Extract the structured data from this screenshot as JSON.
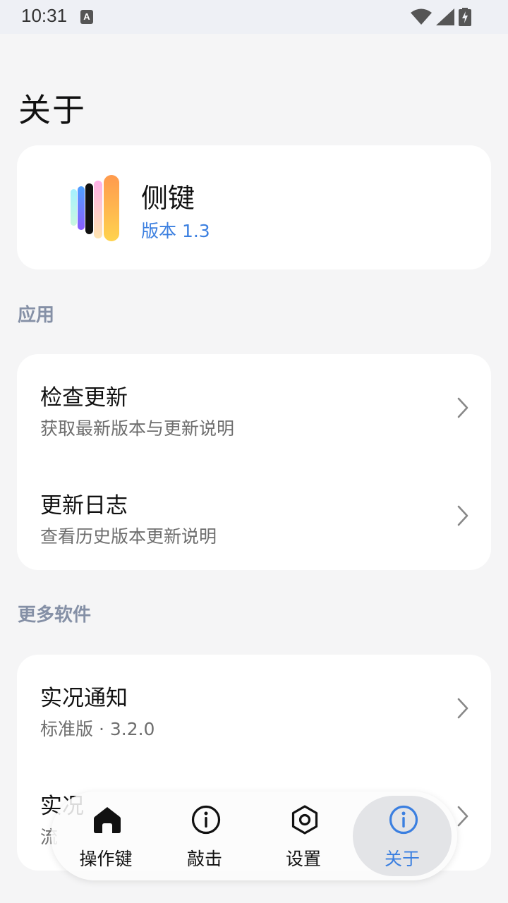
{
  "status_bar": {
    "time": "10:31",
    "notification_icon": "A",
    "icons": [
      "wifi-icon",
      "signal-icon",
      "battery-charging-icon"
    ]
  },
  "page": {
    "title": "关于"
  },
  "app": {
    "name": "侧键",
    "version": "版本 1.3"
  },
  "sections": {
    "app_title": "应用",
    "more_title": "更多软件"
  },
  "app_rows": [
    {
      "title": "检查更新",
      "subtitle": "获取最新版本与更新说明"
    },
    {
      "title": "更新日志",
      "subtitle": "查看历史版本更新说明"
    }
  ],
  "more_rows": [
    {
      "title": "实况通知",
      "subtitle": "标准版 · 3.2.0"
    },
    {
      "title": "实况",
      "subtitle": "流"
    }
  ],
  "bottom_nav": {
    "items": [
      {
        "label": "操作键",
        "icon": "home-icon"
      },
      {
        "label": "敲击",
        "icon": "info-icon"
      },
      {
        "label": "设置",
        "icon": "settings-hex-icon"
      },
      {
        "label": "关于",
        "icon": "info-icon"
      }
    ],
    "active_index": 3
  },
  "colors": {
    "accent": "#3b7fe0",
    "background": "#f5f5f6",
    "card": "#ffffff",
    "section_title": "#8590a6"
  }
}
